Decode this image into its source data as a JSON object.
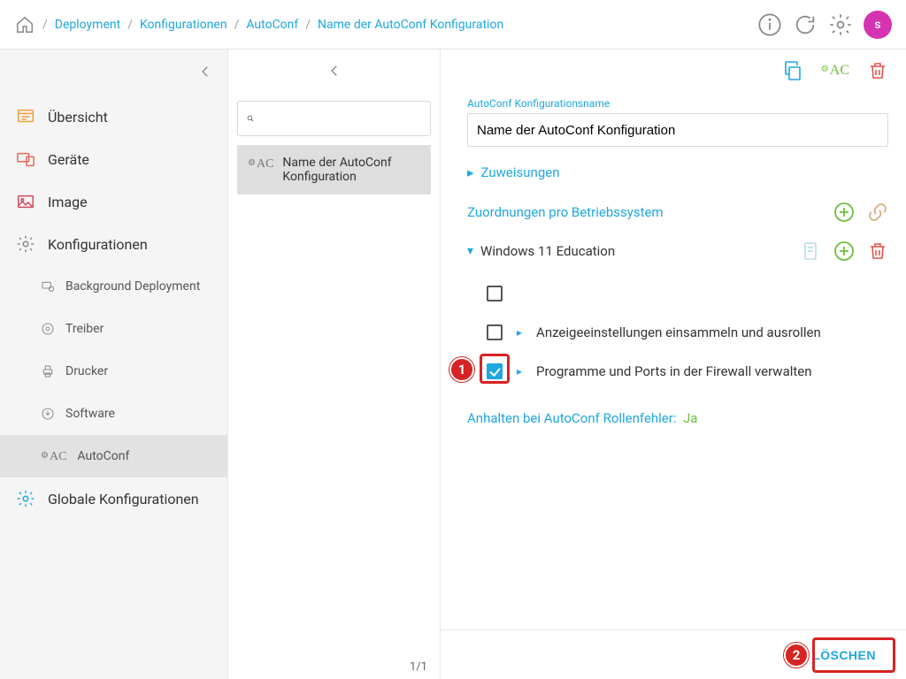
{
  "breadcrumb": {
    "items": [
      "Deployment",
      "Konfigurationen",
      "AutoConf",
      "Name der AutoConf Konfiguration"
    ]
  },
  "topbar": {
    "avatar_initial": "s"
  },
  "sidebar": {
    "items": [
      {
        "label": "Übersicht"
      },
      {
        "label": "Geräte"
      },
      {
        "label": "Image"
      },
      {
        "label": "Konfigurationen"
      }
    ],
    "subitems": [
      {
        "label": "Background Deployment"
      },
      {
        "label": "Treiber"
      },
      {
        "label": "Drucker"
      },
      {
        "label": "Software"
      },
      {
        "label": "AutoConf"
      }
    ],
    "global": {
      "label": "Globale Konfigurationen"
    }
  },
  "midcol": {
    "search_placeholder": "",
    "selected": {
      "label": "Name der AutoConf Konfiguration"
    },
    "pager": "1/1"
  },
  "detail": {
    "name_label": "AutoConf Konfigurationsname",
    "name_value": "Name der AutoConf Konfiguration",
    "assignments_label": "Zuweisungen",
    "per_os_label": "Zuordnungen pro Betriebssystem",
    "os": {
      "name": "Windows 11 Education",
      "roles": [
        {
          "label": "",
          "checked": false
        },
        {
          "label": "Anzeigeeinstellungen einsammeln und ausrollen",
          "checked": false
        },
        {
          "label": "Programme und Ports in der Firewall verwalten",
          "checked": true
        }
      ]
    },
    "halt_label": "Anhalten bei AutoConf Rollenfehler:",
    "halt_value": "Ja",
    "delete_label": "LÖSCHEN"
  },
  "callouts": {
    "c1": "1",
    "c2": "2"
  }
}
